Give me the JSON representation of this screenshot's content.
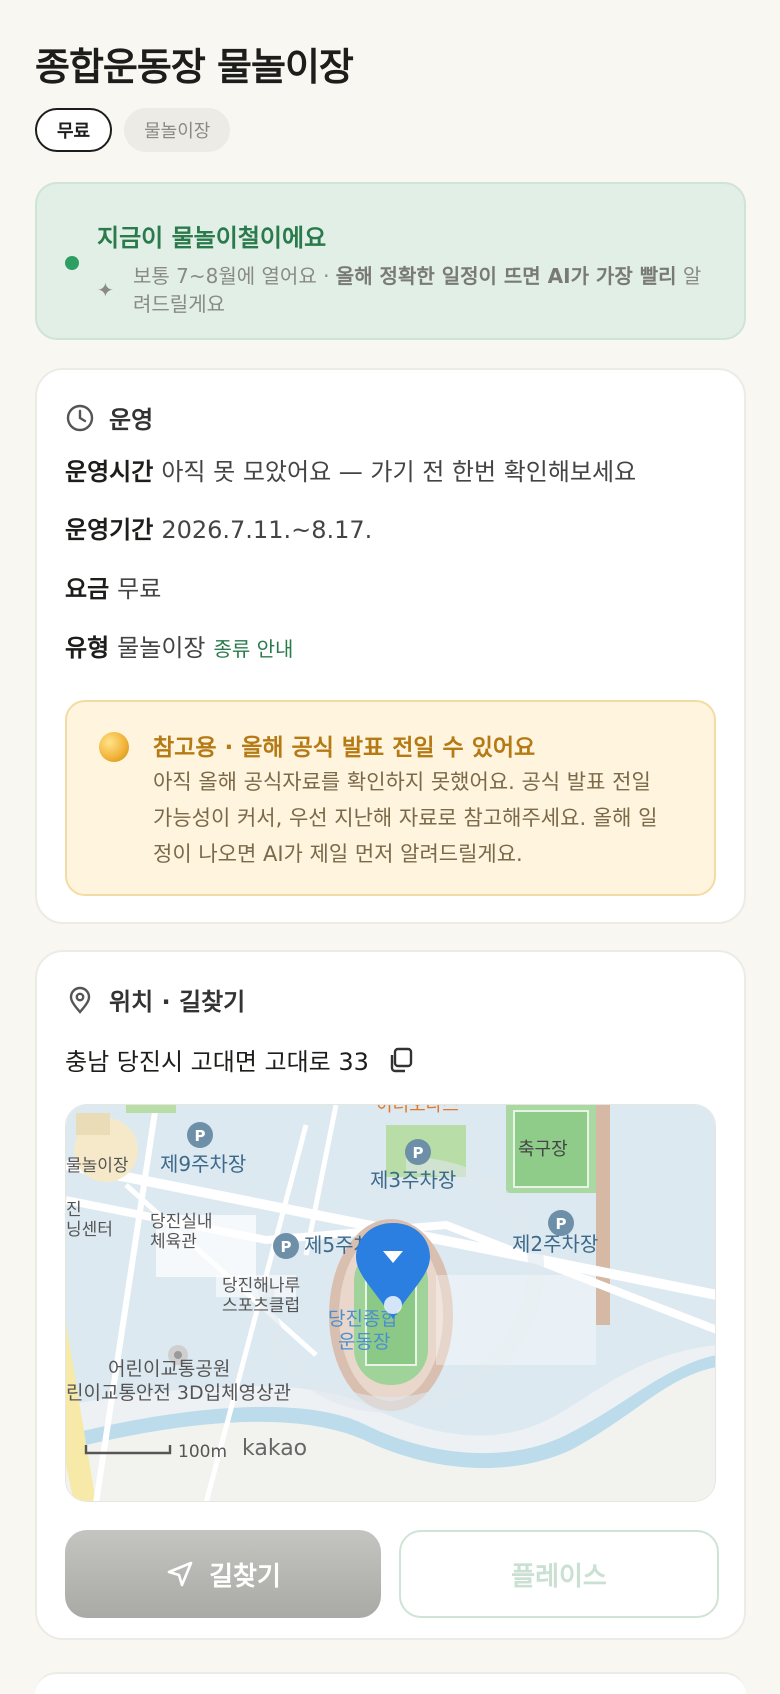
{
  "page": {
    "title": "종합운동장 물놀이장"
  },
  "chips": [
    {
      "label": "무료"
    },
    {
      "label": "물놀이장"
    }
  ],
  "season": {
    "headline": "지금이 물놀이철이에요",
    "desc_normal": "보통 7~8월에 열어요 · ",
    "desc_bold": "올해 정확한 일정이 뜨면 AI가 가장 빨리",
    "desc_tail": "알려드릴게요"
  },
  "ops": {
    "section_label": "운영",
    "hours_key": "운영시간",
    "hours_value": "아직 못 모았어요 — 가기 전 한번 확인해보세요",
    "period_key": "운영기간",
    "period_value": "2026.7.11.~8.17.",
    "fee_key": "요금",
    "fee_value": "무료",
    "type_key": "유형",
    "type_value": "물놀이장",
    "type_link": "종류 안내",
    "notice_title": "참고용 · 올해 공식 발표 전일 수 있어요",
    "notice_body": "아직 올해 공식자료를 확인하지 못했어요. 공식 발표 전일 가능성이 커서, 우선 지난해 자료로 참고해주세요. 올해 일정이 나오면 AI가 제일 먼저 알려드릴게요."
  },
  "location": {
    "section_label": "위치 · 길찾기",
    "address": "충남 당진시 고대면 고대로 33",
    "map": {
      "labels": {
        "pool": "물놀이장",
        "p9": "제9주차장",
        "p3": "제3주차장",
        "p5": "제5주차장",
        "p2": "제2주차장",
        "soccer": "축구장",
        "gym1": "당진실내",
        "gym2": "체육관",
        "club1": "당진해나루",
        "club2": "스포츠클럽",
        "stadium1": "당진종합",
        "stadium2": "운동장",
        "park": "어린이교통공원",
        "theater": "린이교통안전 3D입체영상관",
        "center1": "진",
        "center2": "닝센터",
        "top": "이너오다스",
        "scale": "100m",
        "brand": "kakao"
      }
    },
    "nav_button": "길찾기",
    "place_button": "플레이스"
  },
  "colors": {
    "accent_green": "#2a7a4c",
    "notice_gold": "#b57a14",
    "pin_blue": "#2b7fe0"
  }
}
